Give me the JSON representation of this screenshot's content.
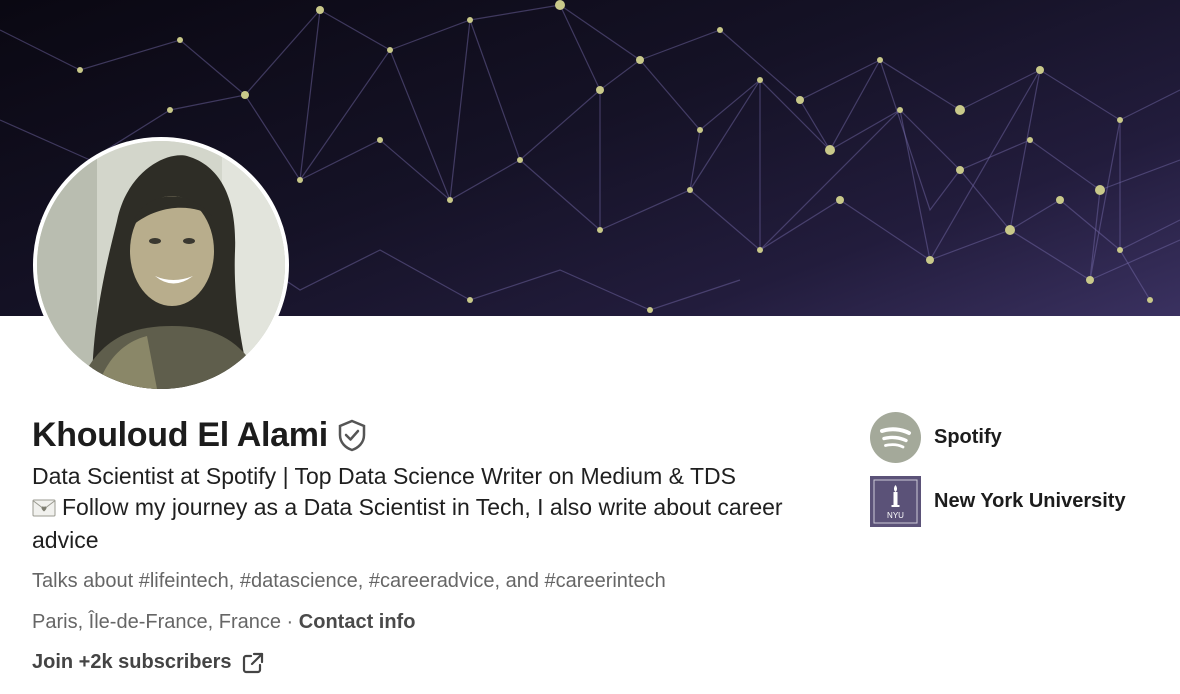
{
  "profile": {
    "name": "Khouloud El Alami",
    "headline_line1": "Data Scientist at Spotify | Top Data Science Writer on Medium & TDS",
    "headline_line2": "Follow my journey as a Data Scientist in Tech, I also write about career advice",
    "talks_about": "Talks about #lifeintech, #datascience, #careeradvice, and #careerintech",
    "location": "Paris, Île-de-France, France",
    "separator": "·",
    "contact_label": "Contact info",
    "subscribe_label": "Join +2k subscribers"
  },
  "organizations": [
    {
      "name": "Spotify",
      "icon": "spotify-logo-icon"
    },
    {
      "name": "New York University",
      "icon": "nyu-logo-icon",
      "logo_text": "NYU"
    }
  ],
  "colors": {
    "banner_dark": "#151226",
    "banner_node": "#c9c98a",
    "accent_gray": "#666666",
    "spotify_logo_bg": "#a4a99a",
    "nyu_logo_bg": "#5b5278"
  }
}
